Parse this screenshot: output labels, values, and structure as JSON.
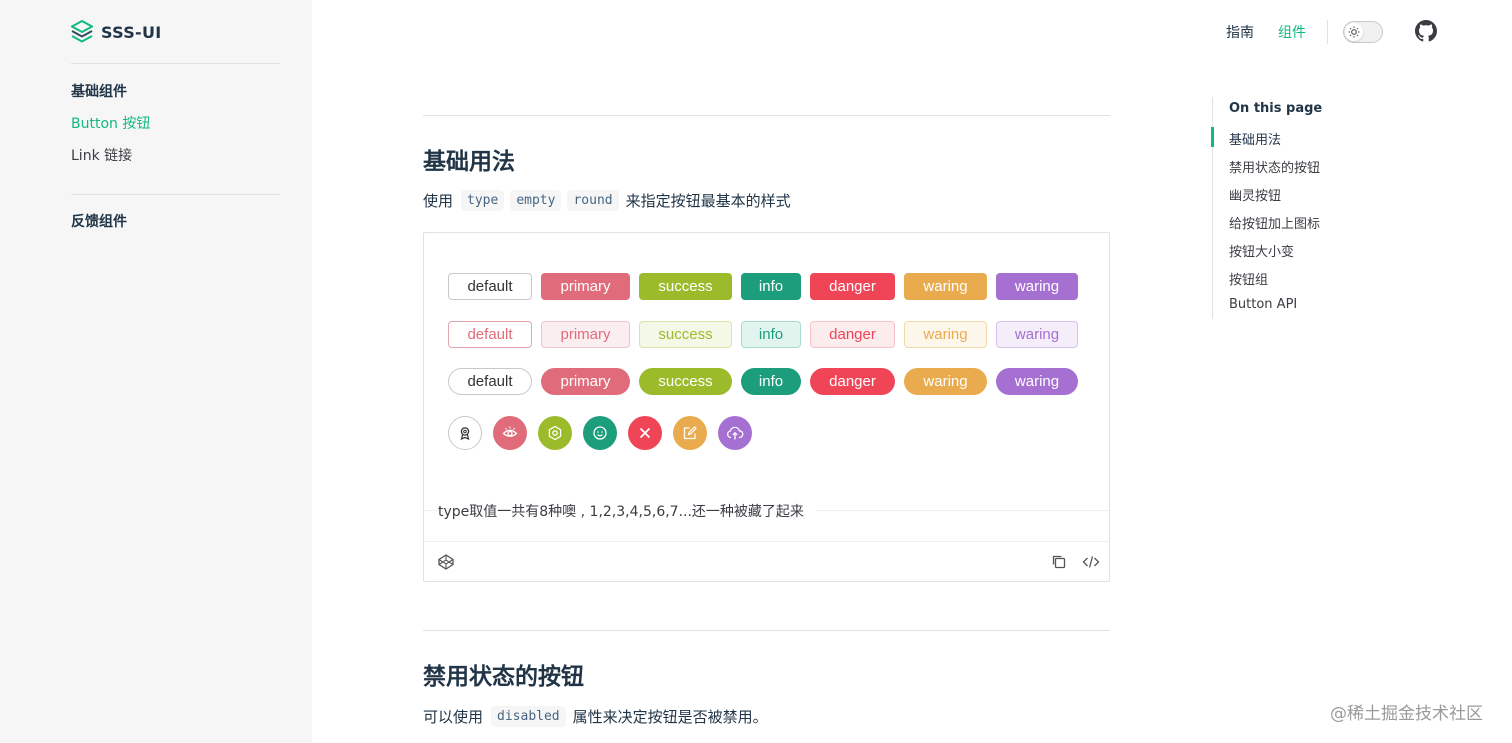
{
  "brand": {
    "name": "SSS-UI"
  },
  "sidebar": {
    "groups": [
      {
        "title": "基础组件",
        "items": [
          {
            "label": "Button 按钮",
            "active": true
          },
          {
            "label": "Link 链接",
            "active": false
          }
        ]
      },
      {
        "title": "反馈组件",
        "items": []
      }
    ]
  },
  "nav": {
    "items": [
      {
        "label": "指南",
        "active": false
      },
      {
        "label": "组件",
        "active": true
      }
    ]
  },
  "section1": {
    "title": "基础用法",
    "desc_prefix": "使用",
    "desc_codes": [
      "type",
      "empty",
      "round"
    ],
    "desc_suffix": "来指定按钮最基本的样式",
    "button_labels": [
      "default",
      "primary",
      "success",
      "info",
      "danger",
      "waring",
      "waring"
    ],
    "demo_description": "type取值一共有8种噢 , 1,2,3,4,5,6,7...还一种被藏了起来"
  },
  "section2": {
    "title": "禁用状态的按钮",
    "desc_prefix": "可以使用",
    "desc_code": "disabled",
    "desc_suffix": "属性来决定按钮是否被禁用。"
  },
  "toc": {
    "title": "On this page",
    "items": [
      "基础用法",
      "禁用状态的按钮",
      "幽灵按钮",
      "给按钮加上图标",
      "按钮大小变",
      "按钮组",
      "Button API"
    ]
  },
  "colors": {
    "accent": "#10b981",
    "primary": "#e06c7b",
    "success": "#9bbb2a",
    "info": "#1c9d7c",
    "danger": "#f04557",
    "waring": "#e9ab4d",
    "purple": "#a66fd2"
  },
  "icons": [
    "award-icon",
    "eye-icon",
    "gear-icon",
    "smile-icon",
    "close-icon",
    "edit-icon",
    "cloud-upload-icon"
  ],
  "watermark": "@稀土掘金技术社区"
}
